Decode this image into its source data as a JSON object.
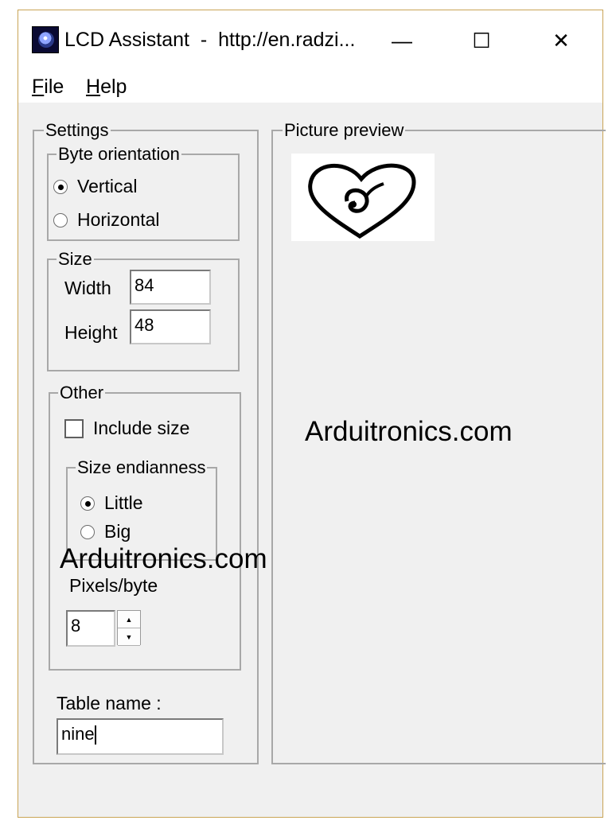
{
  "window": {
    "title": "LCD Assistant  -  http://en.radzi...",
    "app_icon": "eye-icon",
    "controls": {
      "minimize": "—",
      "maximize": "☐",
      "close": "✕"
    }
  },
  "menu": {
    "file": {
      "mnemonic": "F",
      "rest": "ile"
    },
    "help": {
      "mnemonic": "H",
      "rest": "elp"
    }
  },
  "settings": {
    "label": "Settings",
    "byte_orientation": {
      "label": "Byte orientation",
      "options": [
        "Vertical",
        "Horizontal"
      ],
      "selected": "Vertical"
    },
    "size": {
      "label": "Size",
      "width_label": "Width",
      "width_value": "84",
      "height_label": "Height",
      "height_value": "48"
    },
    "other": {
      "label": "Other",
      "include_size_label": "Include size",
      "include_size_checked": false,
      "size_endianness": {
        "label": "Size endianness",
        "options": [
          "Little",
          "Big"
        ],
        "selected": "Little"
      },
      "pixels_per_byte_label": "Pixels/byte",
      "pixels_per_byte_value": "8"
    },
    "table_name_label": "Table name :",
    "table_name_value": "nine"
  },
  "preview": {
    "label": "Picture preview",
    "image": "heart-with-thai-nine-icon"
  },
  "watermarks": [
    "Arduitronics.com",
    "Arduitronics.com"
  ]
}
